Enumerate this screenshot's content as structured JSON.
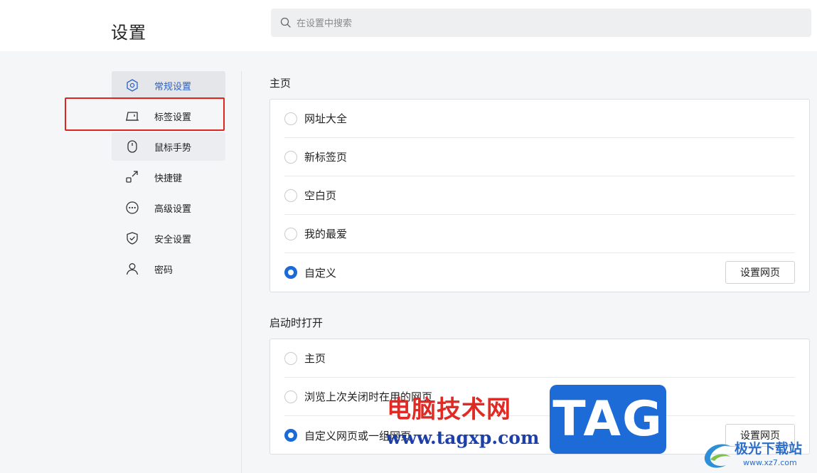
{
  "header": {
    "title": "设置",
    "search_placeholder": "在设置中搜索"
  },
  "sidebar": {
    "items": [
      {
        "label": "常规设置",
        "icon": "hexagon-gear-icon"
      },
      {
        "label": "标签设置",
        "icon": "tab-icon"
      },
      {
        "label": "鼠标手势",
        "icon": "mouse-icon"
      },
      {
        "label": "快捷键",
        "icon": "shortcut-icon"
      },
      {
        "label": "高级设置",
        "icon": "more-dots-icon"
      },
      {
        "label": "安全设置",
        "icon": "shield-check-icon"
      },
      {
        "label": "密码",
        "icon": "user-icon"
      }
    ],
    "active_index": 0,
    "highlighted_index": 1
  },
  "homepage": {
    "title": "主页",
    "options": [
      "网址大全",
      "新标签页",
      "空白页",
      "我的最爱",
      "自定义"
    ],
    "selected_index": 4,
    "button_label": "设置网页"
  },
  "startup": {
    "title": "启动时打开",
    "options": [
      "主页",
      "浏览上次关闭时在用的网页",
      "自定义网页或一组网页"
    ],
    "selected_index": 2,
    "button_label": "设置网页"
  },
  "watermark": {
    "site_name": "电脑技术网",
    "site_url": "www.tagxp.com",
    "badge": "TAG",
    "logo_name": "极光下载站",
    "logo_url": "www.xz7.com"
  },
  "colors": {
    "accent": "#1a6ad8",
    "highlight_border": "#e0251f",
    "watermark_red": "#e02a23",
    "watermark_blue": "#1d6bd6"
  }
}
